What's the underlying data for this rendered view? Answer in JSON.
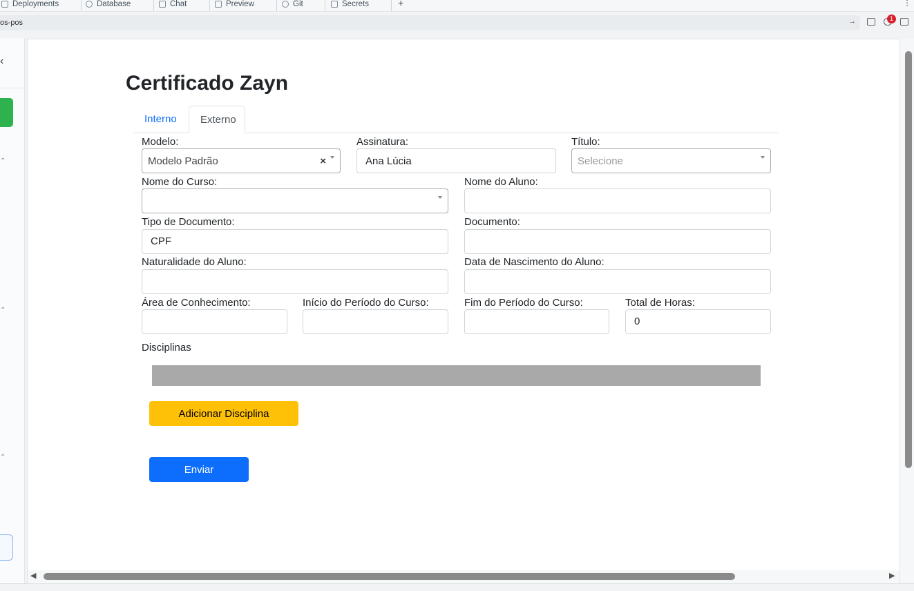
{
  "browser": {
    "tabs": [
      {
        "label": "Deployments",
        "icon": "deploy-icon"
      },
      {
        "label": "Database",
        "icon": "database-icon"
      },
      {
        "label": "Chat",
        "icon": "chat-icon"
      },
      {
        "label": "Preview",
        "icon": "monitor-icon"
      },
      {
        "label": "Git",
        "icon": "git-icon"
      },
      {
        "label": "Secrets",
        "icon": "lock-icon"
      }
    ],
    "add_tab": "+",
    "menu": "⋮",
    "url": "os-pos",
    "notification_count": "1"
  },
  "sidebar": {
    "collapse_icon": "‹"
  },
  "page": {
    "title": "Certificado Zayn",
    "tabs": [
      {
        "label": "Interno",
        "active": false
      },
      {
        "label": "Externo",
        "active": true
      }
    ]
  },
  "form": {
    "modelo": {
      "label": "Modelo:",
      "value": "Modelo Padrão"
    },
    "assinatura": {
      "label": "Assinatura:",
      "value": "Ana Lúcia"
    },
    "titulo": {
      "label": "Título:",
      "placeholder": "Selecione"
    },
    "nome_curso": {
      "label": "Nome do Curso:",
      "value": ""
    },
    "nome_aluno": {
      "label": "Nome do Aluno:",
      "value": ""
    },
    "tipo_documento": {
      "label": "Tipo de Documento:",
      "value": "CPF"
    },
    "documento": {
      "label": "Documento:",
      "value": ""
    },
    "naturalidade": {
      "label": "Naturalidade do Aluno:",
      "value": ""
    },
    "data_nascimento": {
      "label": "Data de Nascimento do Aluno:",
      "value": ""
    },
    "area": {
      "label": "Área de Conhecimento:",
      "value": ""
    },
    "inicio": {
      "label": "Início do Período do Curso:",
      "value": ""
    },
    "fim": {
      "label": "Fim do Período do Curso:",
      "value": ""
    },
    "total_horas": {
      "label": "Total de Horas:",
      "value": "0"
    },
    "disciplinas_label": "Disciplinas",
    "add_disciplina": "Adicionar Disciplina",
    "submit": "Enviar"
  },
  "colors": {
    "primary": "#0d6efd",
    "warning": "#ffc107",
    "grey_bar": "#a9a9a9"
  }
}
